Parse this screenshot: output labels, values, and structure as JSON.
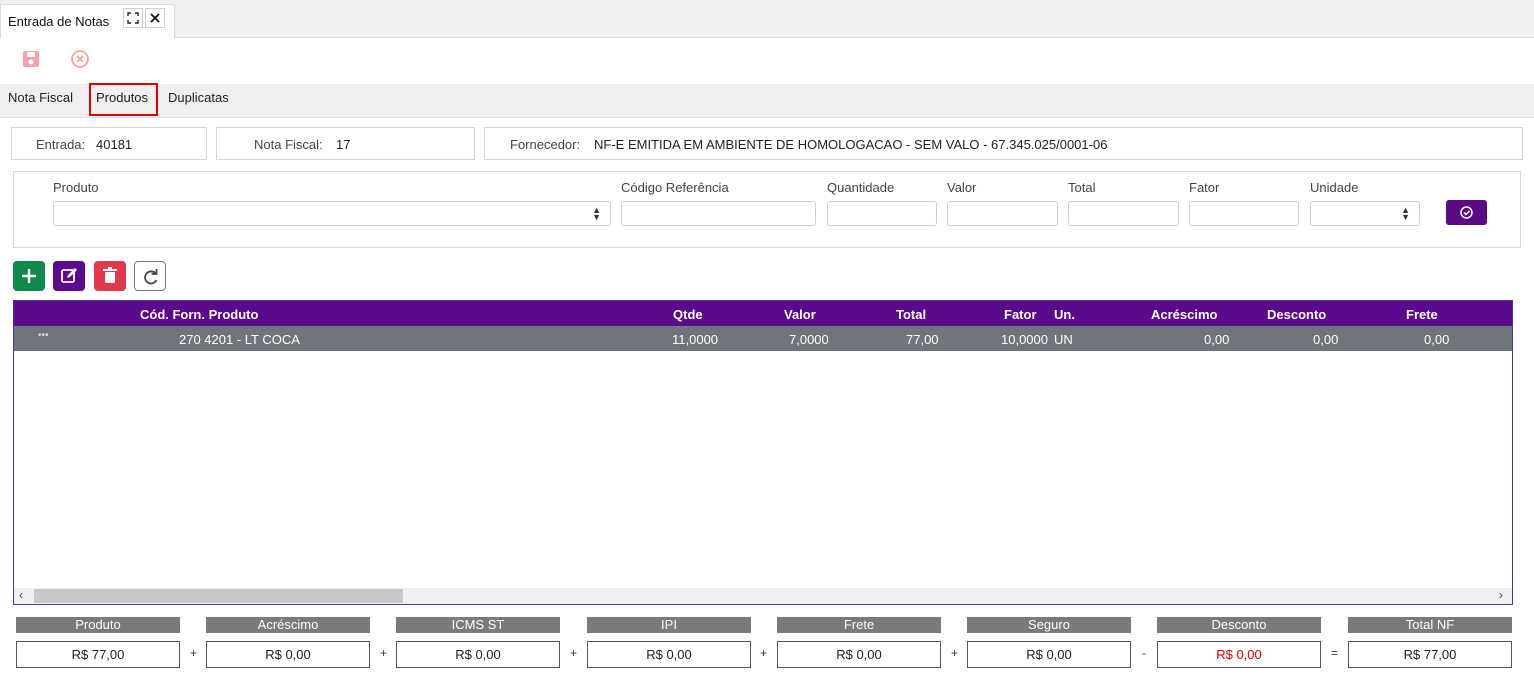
{
  "window": {
    "tab_title": "Entrada de Notas",
    "maximize_icon": "expand-icon",
    "close_icon": "close-icon"
  },
  "toolbar": {
    "save_icon": "save-icon",
    "cancel_icon": "cancel-circle-icon"
  },
  "subtabs": [
    "Nota Fiscal",
    "Produtos",
    "Duplicatas"
  ],
  "active_subtab": "Produtos",
  "info": {
    "entrada_label": "Entrada:",
    "entrada_value": "40181",
    "nota_label": "Nota Fiscal:",
    "nota_value": "17",
    "fornecedor_label": "Fornecedor:",
    "fornecedor_value": "NF-E EMITIDA EM AMBIENTE DE HOMOLOGACAO - SEM VALO - 67.345.025/0001-06"
  },
  "form": {
    "produto": "Produto",
    "codigo": "Código Referência",
    "quantidade": "Quantidade",
    "valor": "Valor",
    "total": "Total",
    "fator": "Fator",
    "unidade": "Unidade"
  },
  "actions": {
    "add": "plus-icon",
    "edit": "edit-icon",
    "delete": "trash-icon",
    "refresh": "refresh-icon"
  },
  "grid": {
    "columns": [
      "Cód. Forn. Produto",
      "Qtde",
      "Valor",
      "Total",
      "Fator",
      "Un.",
      "Acréscimo",
      "Desconto",
      "Frete"
    ],
    "rows": [
      {
        "menu": "•••",
        "produto": "270 4201 - LT COCA",
        "qtde": "11,0000",
        "valor": "7,0000",
        "total": "77,00",
        "fator": "10,0000",
        "un": "UN",
        "acrescimo": "0,00",
        "desconto": "0,00",
        "frete": "0,00"
      }
    ]
  },
  "totals": {
    "labels": [
      "Produto",
      "Acréscimo",
      "ICMS ST",
      "IPI",
      "Frete",
      "Seguro",
      "Desconto",
      "Total NF"
    ],
    "values": [
      "R$ 77,00",
      "R$ 0,00",
      "R$ 0,00",
      "R$ 0,00",
      "R$ 0,00",
      "R$ 0,00",
      "R$ 0,00",
      "R$ 77,00"
    ],
    "operators": [
      "+",
      "+",
      "+",
      "+",
      "+",
      "-",
      "="
    ]
  },
  "colors": {
    "purple": "#5a0a8c",
    "green": "#0f8a4a",
    "red": "#e0394b",
    "desconto_value": "#e00000"
  }
}
